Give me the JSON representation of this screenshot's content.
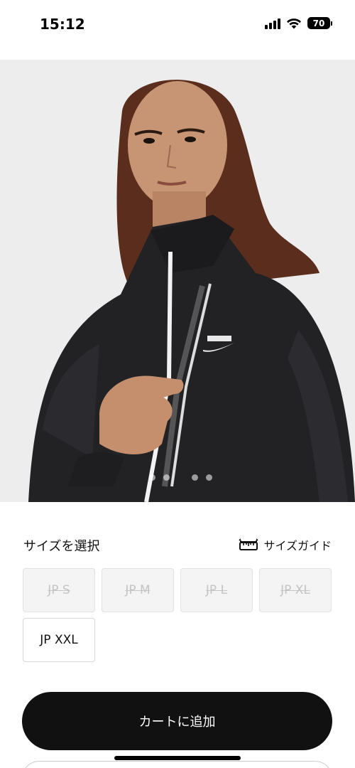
{
  "status_bar": {
    "time": "15:12",
    "battery": "70"
  },
  "product": {
    "image_icon": "product-photo-jacket",
    "carousel": {
      "total": 5,
      "active": 3
    }
  },
  "size_section": {
    "title": "サイズを選択",
    "guide_label": "サイズガイド",
    "sizes": [
      {
        "label": "JP S",
        "available": false
      },
      {
        "label": "JP M",
        "available": false
      },
      {
        "label": "JP L",
        "available": false
      },
      {
        "label": "JP XL",
        "available": false
      },
      {
        "label": "JP XXL",
        "available": true
      }
    ]
  },
  "cta": {
    "add_to_cart": "カートに追加"
  },
  "colors": {
    "primary": "#111111",
    "disabled_text": "#c4c4c4",
    "disabled_bg": "#f4f4f4"
  }
}
